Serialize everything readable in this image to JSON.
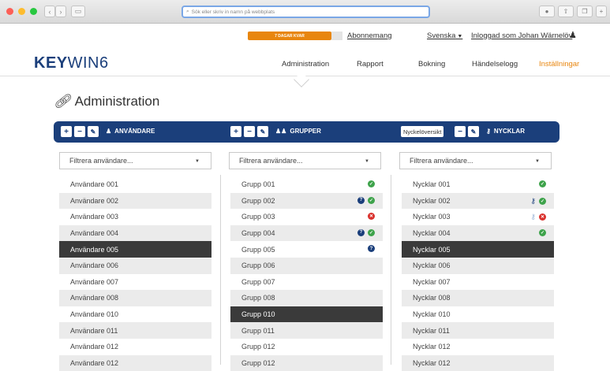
{
  "browser": {
    "address_placeholder": "Sök eller skriv in namn på webbplats"
  },
  "header": {
    "trial_badge": "7 DAGAR KVAR",
    "subscription_link": "Abonnemang",
    "language": "Svenska",
    "logged_in": "Inloggad som Johan Wärnelöv"
  },
  "logo": {
    "bold": "KEY",
    "rest": "WIN6"
  },
  "nav": {
    "items": [
      "Administration",
      "Rapport",
      "Bokning",
      "Händelselogg",
      "Inställningar"
    ],
    "active_color": "#e8860f"
  },
  "page": {
    "title": "Administration"
  },
  "toolbar": {
    "users_label": "ANVÄNDARE",
    "groups_label": "GRUPPER",
    "keys_overview": "Nyckelöversikt",
    "keys_label": "NYCKLAR",
    "bar_color": "#1b3f7b"
  },
  "users": {
    "filter_placeholder": "Filtrera användare...",
    "rows": [
      "Användare 001",
      "Användare 002",
      "Användare 003",
      "Användare 004",
      "Användare 005",
      "Användare 006",
      "Användare 007",
      "Användare 008",
      "Användare 010",
      "Användare 011",
      "Användare 012",
      "Användare 012"
    ],
    "selected_index": 4
  },
  "groups": {
    "filter_placeholder": "Filtrera användare...",
    "rows": [
      "Grupp 001",
      "Grupp 002",
      "Grupp 003",
      "Grupp 004",
      "Grupp 005",
      "Grupp 006",
      "Grupp 007",
      "Grupp 008",
      "Grupp 010",
      "Grupp 011",
      "Grupp 012",
      "Grupp 012"
    ],
    "selected_index": 8,
    "status_icons": [
      [
        "ok"
      ],
      [
        "info",
        "ok"
      ],
      [
        "bad"
      ],
      [
        "info",
        "ok"
      ],
      [
        "info"
      ],
      [],
      [],
      [],
      [],
      [],
      [],
      []
    ]
  },
  "keys": {
    "filter_placeholder": "Filtrera användare...",
    "rows": [
      "Nycklar 001",
      "Nycklar 002",
      "Nycklar 003",
      "Nycklar 004",
      "Nycklar 005",
      "Nycklar 006",
      "Nycklar 007",
      "Nycklar 008",
      "Nycklar 010",
      "Nycklar 011",
      "Nycklar 012",
      "Nycklar 012"
    ],
    "selected_index": 4,
    "status_icons": [
      [
        "ok"
      ],
      [
        "key",
        "ok"
      ],
      [
        "key-faded",
        "bad"
      ],
      [
        "ok"
      ],
      [],
      [],
      [],
      [],
      [],
      [],
      [],
      []
    ]
  }
}
